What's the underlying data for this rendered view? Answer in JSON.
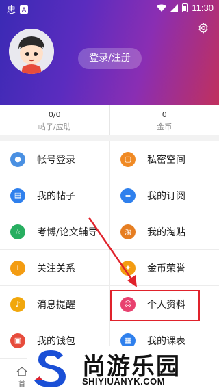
{
  "status_bar": {
    "time": "11:30",
    "left_glyph": "忠",
    "badge": "A"
  },
  "header": {
    "login_label": "登录/注册"
  },
  "stats": [
    {
      "value": "0/0",
      "label": "帖子/应助"
    },
    {
      "value": "0",
      "label": "金币"
    }
  ],
  "menu": [
    {
      "label": "帐号登录",
      "icon": "user-icon",
      "color": "#4a90e2",
      "glyph": "👤"
    },
    {
      "label": "私密空间",
      "icon": "lock-icon",
      "color": "#f08a24",
      "glyph": "🔒"
    },
    {
      "label": "我的帖子",
      "icon": "docs-icon",
      "color": "#2f80ed",
      "glyph": "▤"
    },
    {
      "label": "我的订阅",
      "icon": "list-icon",
      "color": "#2f80ed",
      "glyph": "≡"
    },
    {
      "label": "考博/论文辅导",
      "icon": "star-icon",
      "color": "#27ae60",
      "glyph": "☆"
    },
    {
      "label": "我的淘贴",
      "icon": "tao-icon",
      "color": "#e67e22",
      "glyph": "淘"
    },
    {
      "label": "关注关系",
      "icon": "follow-icon",
      "color": "#f39c12",
      "glyph": "+"
    },
    {
      "label": "金币荣誉",
      "icon": "honor-icon",
      "color": "#f39c12",
      "glyph": "✦"
    },
    {
      "label": "消息提醒",
      "icon": "bell-icon",
      "color": "#f1a70c",
      "glyph": "♪"
    },
    {
      "label": "个人资料",
      "icon": "profile-icon",
      "color": "#e8416f",
      "glyph": "☺"
    },
    {
      "label": "我的钱包",
      "icon": "wallet-icon",
      "color": "#e74c3c",
      "glyph": "▣"
    },
    {
      "label": "我的课表",
      "icon": "schedule-icon",
      "color": "#2f80ed",
      "glyph": "▦"
    }
  ],
  "tabbar": {
    "home_label": "首"
  },
  "watermark": {
    "cn": "尚游乐园",
    "en": "SHIYIUANYK.COM"
  }
}
